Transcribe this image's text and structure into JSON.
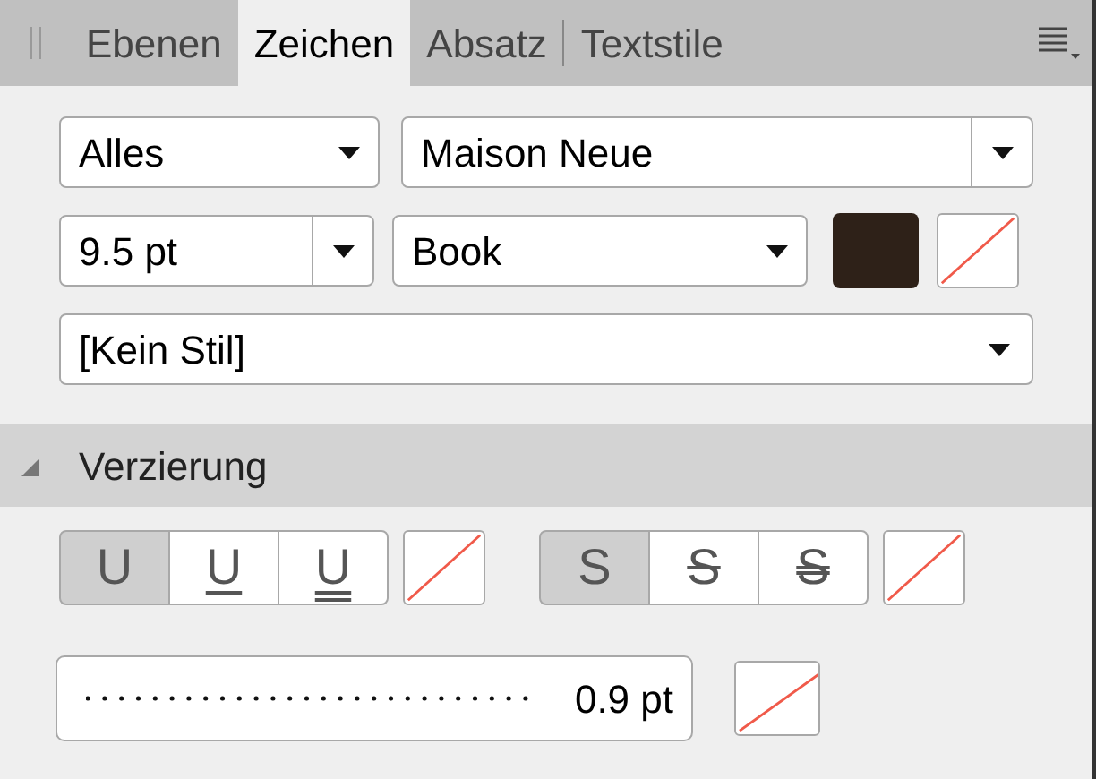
{
  "tabs": [
    {
      "label": "Ebenen",
      "selected": false
    },
    {
      "label": "Zeichen",
      "selected": true
    },
    {
      "label": "Absatz",
      "selected": false
    },
    {
      "label": "Textstile",
      "selected": false
    }
  ],
  "row1": {
    "scope": "Alles",
    "font": "Maison Neue"
  },
  "row2": {
    "size": "9.5 pt",
    "weight": "Book",
    "swatches": [
      {
        "kind": "fill",
        "color": "#2e2118"
      }
    ]
  },
  "style": "[Kein Stil]",
  "section": {
    "title": "Verzierung",
    "expanded": true
  },
  "underline": [
    {
      "label": "U",
      "kind": "none",
      "selected": true
    },
    {
      "label": "U",
      "kind": "single",
      "selected": false
    },
    {
      "label": "U",
      "kind": "double",
      "selected": false
    }
  ],
  "strike": [
    {
      "label": "S",
      "kind": "none",
      "selected": true
    },
    {
      "label": "S",
      "kind": "single",
      "selected": false
    },
    {
      "label": "S",
      "kind": "double",
      "selected": false
    }
  ],
  "stroke": {
    "value": "0.9 pt"
  }
}
